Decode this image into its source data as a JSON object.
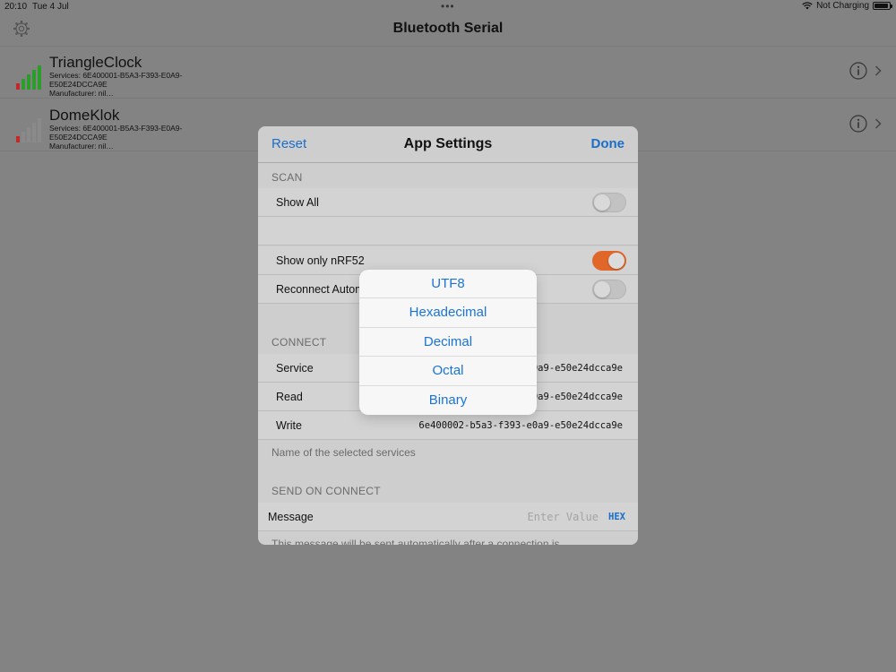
{
  "status": {
    "time": "20:10",
    "date": "Tue 4 Jul",
    "charging": "Not Charging",
    "dots": "•••"
  },
  "navbar": {
    "title": "Bluetooth Serial"
  },
  "devices": [
    {
      "name": "TriangleClock",
      "services_line1": "Services: 6E400001-B5A3-F393-E0A9-",
      "services_line2": "E50E24DCCA9E",
      "manufacturer": "Manufacturer: nil…",
      "signal_color": "#2a9d2a"
    },
    {
      "name": "DomeKlok",
      "services_line1": "Services: 6E400001-B5A3-F393-E0A9-",
      "services_line2": "E50E24DCCA9E",
      "manufacturer": "Manufacturer: nil…",
      "signal_color": "#8a8a8a"
    }
  ],
  "modal": {
    "reset_label": "Reset",
    "title": "App Settings",
    "done_label": "Done",
    "scan": {
      "header": "SCAN",
      "show_all_label": "Show All",
      "show_all_on": false,
      "show_nrf_label": "Show only nRF52",
      "show_nrf_on": true,
      "reconnect_label": "Reconnect Autom",
      "reconnect_on": false
    },
    "connect": {
      "header": "CONNECT",
      "service_label": "Service",
      "service_value": "e0a9-e50e24dcca9e",
      "read_label": "Read",
      "read_value": "e0a9-e50e24dcca9e",
      "write_label": "Write",
      "write_value": "6e400002-b5a3-f393-e0a9-e50e24dcca9e",
      "footer": "Name of the selected services"
    },
    "send": {
      "header": "SEND ON CONNECT",
      "message_label": "Message",
      "placeholder": "Enter Value",
      "hex_label": "HEX",
      "footer": "This message will be sent automatically after a connection is"
    }
  },
  "popover": {
    "options": [
      "UTF8",
      "Hexadecimal",
      "Decimal",
      "Octal",
      "Binary"
    ]
  },
  "colors": {
    "accent": "#1a74d6",
    "toggle_on": "#e0662a",
    "signal_red": "#c62828"
  }
}
